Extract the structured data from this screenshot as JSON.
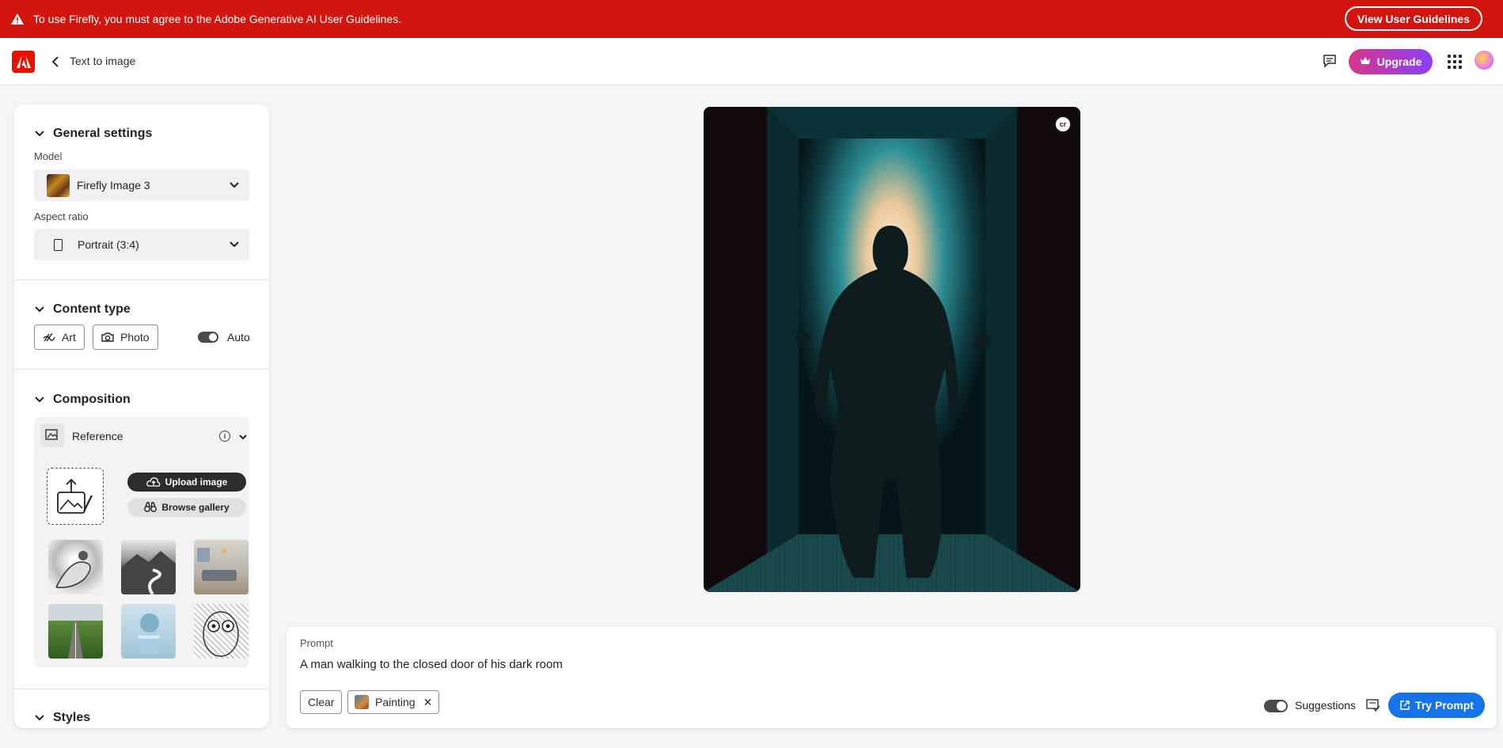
{
  "banner": {
    "message": "To use Firefly, you must agree to the Adobe Generative AI User Guidelines.",
    "button_label": "View User Guidelines",
    "color": "#d31510"
  },
  "nav": {
    "breadcrumb": "Text to image",
    "upgrade_label": "Upgrade",
    "brand_color": "#eb1000"
  },
  "panel": {
    "general_settings": {
      "title": "General settings",
      "model_label": "Model",
      "model_value": "Firefly Image 3",
      "aspect_label": "Aspect ratio",
      "aspect_value": "Portrait (3:4)"
    },
    "content_type": {
      "title": "Content type",
      "art_label": "Art",
      "photo_label": "Photo",
      "auto_label": "Auto",
      "auto_on": true
    },
    "composition": {
      "title": "Composition",
      "reference_label": "Reference",
      "upload_label": "Upload image",
      "gallery_label": "Browse gallery",
      "thumbnails": [
        "bird-sketch",
        "mountain-river",
        "living-room",
        "green-field-road",
        "blue-sphere",
        "owl-sketch"
      ]
    },
    "styles": {
      "title": "Styles"
    }
  },
  "main_image": {
    "badge": "cr"
  },
  "prompt": {
    "label": "Prompt",
    "text": "A man walking to the closed door of his dark room",
    "clear_label": "Clear",
    "chip_label": "Painting",
    "suggestions_label": "Suggestions",
    "suggestions_on": true,
    "try_label": "Try Prompt",
    "accent": "#1473e6"
  }
}
